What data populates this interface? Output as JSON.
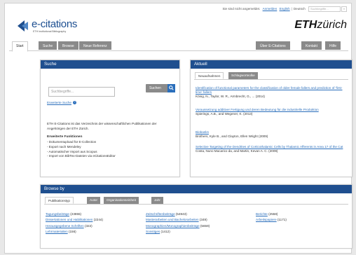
{
  "topbar": {
    "status_text": "Sie sind nicht angemeldet.",
    "login_link": "Anmelden",
    "lang_en": "English",
    "lang_current": "Deutsch",
    "search_placeholder": "Suchbegriffe...",
    "search_btn": "»"
  },
  "logo": {
    "title": "e-citations",
    "subtitle": "ETH Institutional Bibliography",
    "eth_bold": "ETH",
    "eth_rest": "zürich"
  },
  "nav": {
    "tabs": [
      "Start",
      "Suche",
      "Browse",
      "Neue Referenz"
    ],
    "right": [
      "Über E-Citations",
      "Kontakt",
      "Hilfe"
    ]
  },
  "suche": {
    "heading": "Suche",
    "placeholder": "Suchbegriffe...",
    "button": "Suchen",
    "advanced": "Erweiterte Suche",
    "help_icon_glyph": "?",
    "description": "ETH E-Citations ist das Verzeichnis der wissenschaftlichen Publikationen der Angehörigen der ETH Zürich.",
    "extended_title": "Erweiterte Funktionen",
    "extended_items": [
      "- Dokumentupload für E-Collection",
      "- Export nach Mendeley",
      "- Automatischer Import aus Scopus",
      "- Import von BibTex-Dateien via eCitationsEditor"
    ]
  },
  "aktuell": {
    "heading": "Aktuell",
    "tabs": [
      "Neuaufnahmen",
      "Schlagworteolke"
    ],
    "entries": [
      {
        "title": "Identification of functional parameters for the classification of older female fallers and prediction of 'first- time' fallers",
        "authors": "König, N., Taylor, W. R., Armbrecht, G., ... (2014)"
      },
      {
        "title": "Voraussetzung additiver Fertigung und deren Bedeutung für die industrielle Produktion",
        "authors": "Spierings, A.B., and Wegener, K. (2013)"
      },
      {
        "title": "Biobanks",
        "authors": "Brothers, Kyle B., and Clayton, Ellen Wright (2009)"
      },
      {
        "title": "Selective Targeting of the Dendrites of Corticothalamic Cells by Thalamic Afferents in Area 17 of the Cat",
        "authors": "Costa, Nuno Macarico da, and Martin, Kevan A. C. (2009)"
      }
    ]
  },
  "browse": {
    "heading": "Browse by",
    "tabs": [
      "Publikationstyp",
      "Autor",
      "Organisationseinheit",
      "Jahr"
    ],
    "col1": [
      {
        "label": "Tagungsbeiträge",
        "count": "(23855)"
      },
      {
        "label": "Dissertationen und Habilitationen",
        "count": "(2244)"
      },
      {
        "label": "Herausgegebene Schriften",
        "count": "(322)"
      },
      {
        "label": "Lehrmaterialien",
        "count": "(156)"
      }
    ],
    "col2": [
      {
        "label": "Zeitschriftenbeiträge",
        "count": "(54943)"
      },
      {
        "label": "Masterarbeiten und Bachelorarbeiten",
        "count": "(349)"
      },
      {
        "label": "Monographien/Monographienbeiträge",
        "count": "(5659)"
      },
      {
        "label": "Sonstiges",
        "count": "(1412)"
      }
    ],
    "col3": [
      {
        "label": "Berichte",
        "count": "(2558)"
      },
      {
        "label": "Arbeitspapiere",
        "count": "(1171)"
      }
    ]
  },
  "colors": {
    "brand_blue": "#1f4f8f",
    "link_blue": "#2a6ebb",
    "tab_grey": "#8a8a8a"
  }
}
